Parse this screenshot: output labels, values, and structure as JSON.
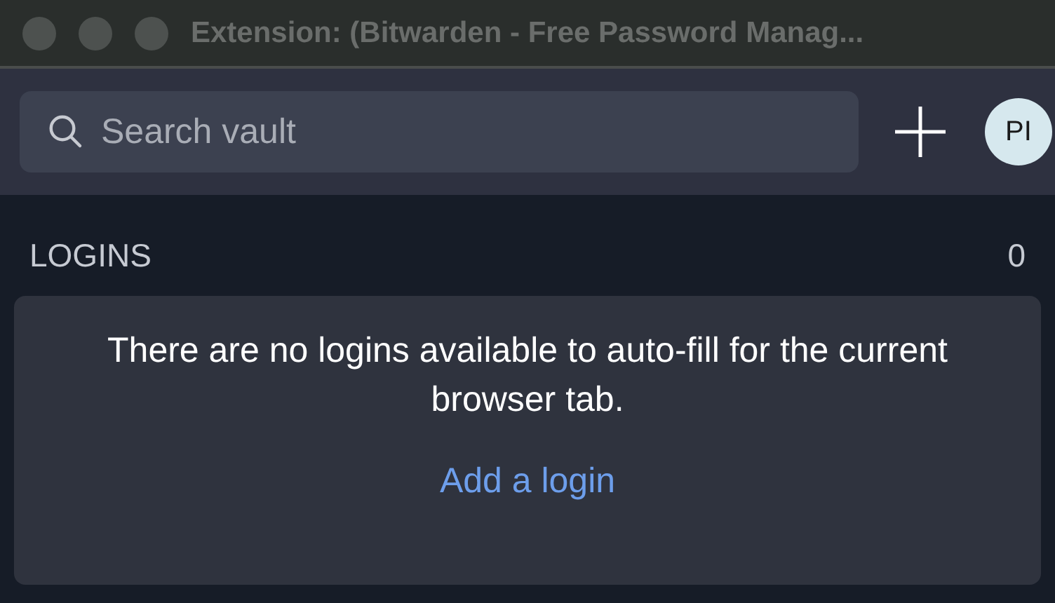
{
  "window": {
    "title": "Extension: (Bitwarden - Free Password Manag..."
  },
  "header": {
    "search": {
      "placeholder": "Search vault"
    },
    "avatar": "PI"
  },
  "section": {
    "title": "LOGINS",
    "count": "0"
  },
  "empty_state": {
    "message": "There are no logins available to auto-fill for the current browser tab.",
    "link": "Add a login"
  }
}
